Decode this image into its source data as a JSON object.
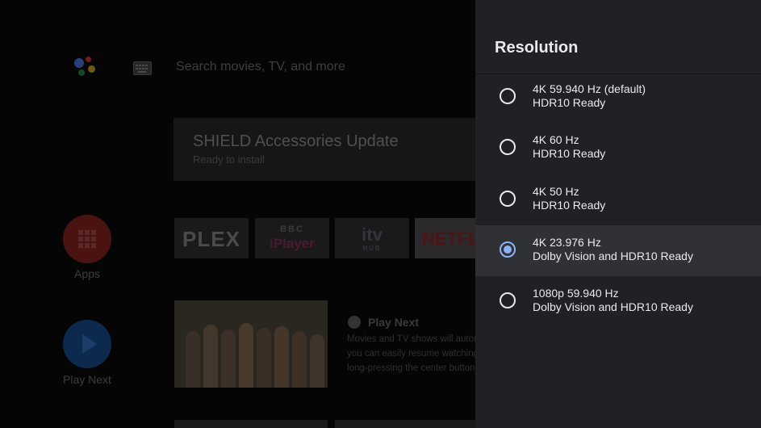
{
  "colors": {
    "panel_bg": "#202124",
    "selected_row_bg": "#303134",
    "radio_selected": "#8ab4f8",
    "text_primary": "#e8eaed",
    "netflix_red": "#e50914",
    "apps_red": "#e53935",
    "playnext_blue": "#1a73e8"
  },
  "home": {
    "search_placeholder": "Search movies, TV, and more",
    "update_card": {
      "title": "SHIELD Accessories Update",
      "subtitle": "Ready to install"
    },
    "rail": {
      "apps_label": "Apps",
      "play_next_label": "Play Next"
    },
    "app_tiles": [
      {
        "name": "PLEX"
      },
      {
        "name": "BBC iPlayer",
        "line1": "BBC",
        "line2": "iPlayer"
      },
      {
        "name": "itv hub",
        "line1": "itv",
        "line2": "HUB"
      },
      {
        "name": "NETFLIX"
      }
    ],
    "play_next": {
      "title": "Play Next",
      "desc_lines": [
        "Movies and TV shows will autom",
        "you can easily resume watching",
        "long-pressing the center button"
      ]
    }
  },
  "resolution_panel": {
    "title": "Resolution",
    "options": [
      {
        "main": "4K 59.940 Hz (default)",
        "sub": "HDR10 Ready",
        "selected": false
      },
      {
        "main": "4K 60 Hz",
        "sub": "HDR10 Ready",
        "selected": false
      },
      {
        "main": "4K 50 Hz",
        "sub": "HDR10 Ready",
        "selected": false
      },
      {
        "main": "4K 23.976 Hz",
        "sub": "Dolby Vision and HDR10 Ready",
        "selected": true
      },
      {
        "main": "1080p 59.940 Hz",
        "sub": "Dolby Vision and HDR10 Ready",
        "selected": false
      }
    ]
  }
}
